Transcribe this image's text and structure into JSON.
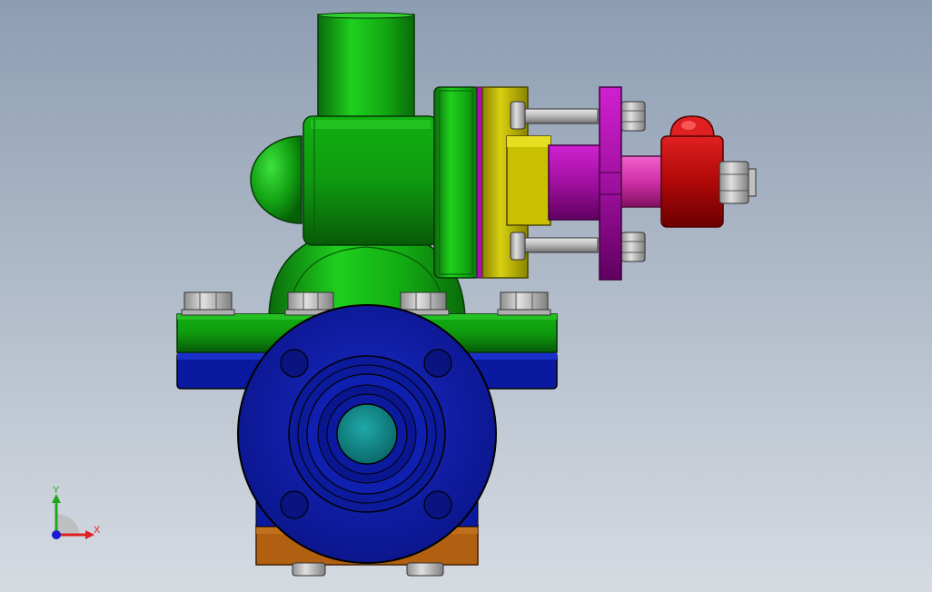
{
  "viewport": {
    "background_top": "#8d9db2",
    "background_bottom": "#d6dbe2"
  },
  "triad": {
    "x_label": "X",
    "y_label": "Y",
    "x_color": "#e02020",
    "y_color": "#1fa81f",
    "z_color": "#1a1ad0"
  },
  "model": {
    "parts": [
      {
        "name": "top-cylinder",
        "color": "#12b012"
      },
      {
        "name": "dome-cap",
        "color": "#10a010"
      },
      {
        "name": "main-body",
        "color": "#0fa00f"
      },
      {
        "name": "base-flange-top",
        "color": "#118c11"
      },
      {
        "name": "base-flange-bottom",
        "color": "#0a1aa0"
      },
      {
        "name": "round-flange",
        "color": "#0d1899"
      },
      {
        "name": "bore",
        "color": "#0e8a8a"
      },
      {
        "name": "yellow-adapter",
        "color": "#c8c000"
      },
      {
        "name": "magenta-sleeve",
        "color": "#c010c0"
      },
      {
        "name": "pink-shaft",
        "color": "#e040b0"
      },
      {
        "name": "red-end-cap",
        "color": "#d01010"
      },
      {
        "name": "orange-foot",
        "color": "#b06010"
      }
    ]
  }
}
